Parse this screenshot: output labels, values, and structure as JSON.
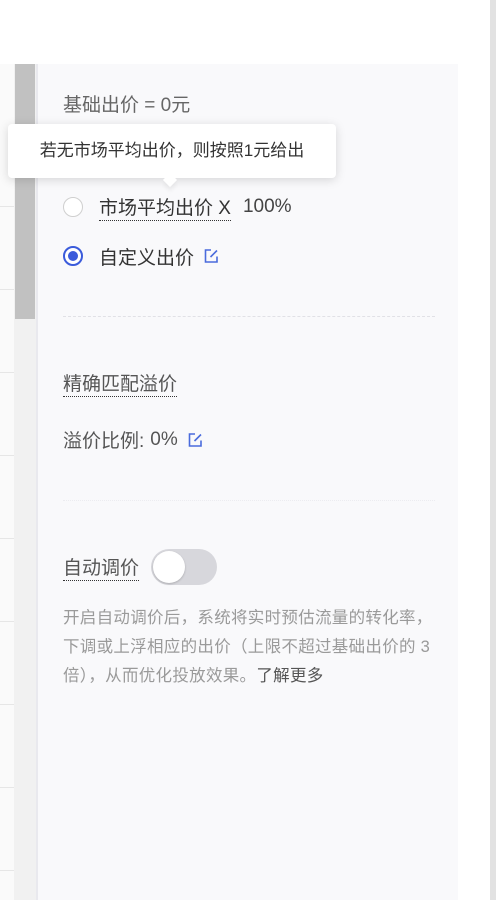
{
  "base_price": "基础出价 = 0元",
  "tooltip": "若无市场平均出价，则按照1元给出",
  "options": {
    "market": {
      "label": "市场平均出价 X",
      "percent": "100%",
      "selected": false
    },
    "custom": {
      "label": "自定义出价",
      "selected": true
    }
  },
  "precise_match": {
    "title": "精确匹配溢价",
    "ratio_label": "溢价比例:",
    "ratio_value": "0%"
  },
  "auto_bid": {
    "label": "自动调价",
    "enabled": false,
    "description": "开启自动调价后，系统将实时预估流量的转化率，下调或上浮相应的出价（上限不超过基础出价的 3 倍），从而优化投放效果。",
    "learn_more": "了解更多"
  },
  "icons": {
    "edit": "edit-icon"
  },
  "colors": {
    "accent": "#3b5bdb",
    "toggle_off": "#d7d7dc",
    "muted_text": "#9a9a9a"
  }
}
